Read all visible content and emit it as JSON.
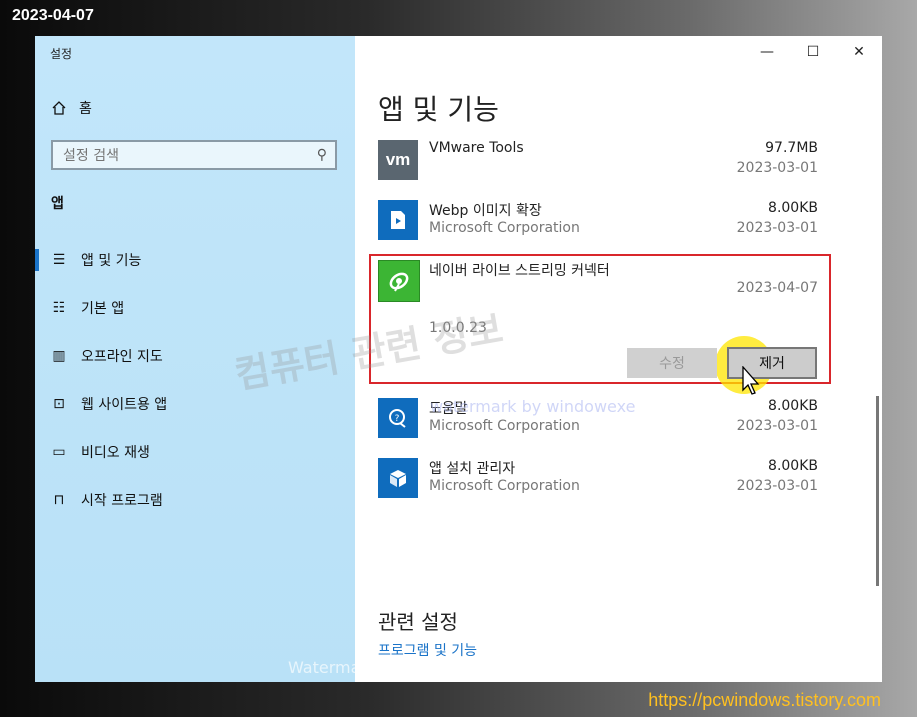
{
  "screenshot": {
    "date": "2023-04-07",
    "blog_url": "https://pcwindows.tistory.com"
  },
  "window": {
    "title": "설정",
    "controls": {
      "minimize": "—",
      "maximize": "☐",
      "close": "✕"
    }
  },
  "sidebar": {
    "home_label": "홈",
    "search_placeholder": "설정 검색",
    "section": "앱",
    "items": [
      {
        "label": "앱 및 기능",
        "icon": "apps-features-icon",
        "active": true
      },
      {
        "label": "기본 앱",
        "icon": "default-apps-icon"
      },
      {
        "label": "오프라인 지도",
        "icon": "offline-maps-icon"
      },
      {
        "label": "웹 사이트용 앱",
        "icon": "apps-for-websites-icon"
      },
      {
        "label": "비디오 재생",
        "icon": "video-playback-icon"
      },
      {
        "label": "시작 프로그램",
        "icon": "startup-icon"
      }
    ]
  },
  "main": {
    "title": "앱 및 기능",
    "apps": [
      {
        "name": "VMware Tools",
        "publisher": "",
        "size": "97.7MB",
        "date": "2023-03-01",
        "icon": "vmware-icon",
        "icon_color": "#5a6670"
      },
      {
        "name": "Webp 이미지 확장",
        "publisher": "Microsoft Corporation",
        "size": "8.00KB",
        "date": "2023-03-01",
        "icon": "webp-icon",
        "icon_color": "#0f6cbd"
      },
      {
        "name": "네이버 라이브 스트리밍 커넥터",
        "version": "1.0.0.23",
        "date": "2023-04-07",
        "icon": "naver-satellite-icon",
        "icon_color": "#3cb534",
        "selected": true
      },
      {
        "name": "도움말",
        "publisher": "Microsoft Corporation",
        "size": "8.00KB",
        "date": "2023-03-01",
        "icon": "help-icon",
        "icon_color": "#0f6cbd"
      },
      {
        "name": "앱 설치 관리자",
        "publisher": "Microsoft Corporation",
        "size": "8.00KB",
        "date": "2023-03-01",
        "icon": "app-installer-icon",
        "icon_color": "#0f6cbd"
      }
    ],
    "buttons": {
      "modify": "수정",
      "remove": "제거"
    },
    "related_title": "관련 설정",
    "related_link": "프로그램 및 기능"
  },
  "watermarks": {
    "main": "컴퓨터 관련 정보",
    "line": "watermark by windowexe",
    "bottom": "Watermarked by WindowexeWatermark"
  }
}
